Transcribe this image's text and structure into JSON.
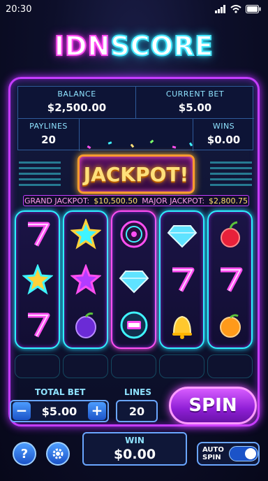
{
  "status_bar": {
    "time": "20:30",
    "icons": [
      "signal-icon",
      "wifi-icon",
      "battery-icon"
    ]
  },
  "logo": {
    "part1": "IDN",
    "part2": "SCORE"
  },
  "info": {
    "balance_label": "BALANCE",
    "balance_value": "$2,500.00",
    "bet_label": "CURRENT BET",
    "bet_value": "$5.00",
    "paylines_label": "PAYLINES",
    "paylines_value": "20",
    "wins_label": "WINS",
    "wins_value": "$0.00"
  },
  "jackpot": {
    "sign": "JACKPOT!",
    "grand_label": "GRAND JACKPOT:",
    "grand_value": "$10,500.50",
    "major_label": "MAJOR JACKPOT:",
    "major_value": "$2,800.75"
  },
  "reels": [
    [
      "seven-icon",
      "star-icon",
      "seven-icon"
    ],
    [
      "star-icon",
      "star-icon",
      "plum-icon"
    ],
    [
      "bonus-wheel-icon",
      "diamond-icon",
      "slot-machine-icon"
    ],
    [
      "diamond-icon",
      "seven-icon",
      "bell-icon"
    ],
    [
      "cherry-icon",
      "seven-icon",
      "orange-icon"
    ]
  ],
  "controls": {
    "total_bet_label": "TOTAL BET",
    "total_bet_value": "$5.00",
    "minus": "−",
    "plus": "+",
    "lines_label": "LINES",
    "lines_value": "20",
    "spin_label": "SPIN",
    "help": "?",
    "win_label": "WIN",
    "win_value": "$0.00",
    "auto_spin_label": "AUTO SPIN",
    "auto_spin_on": true
  },
  "colors": {
    "neon_pink": "#ff4ff2",
    "neon_cyan": "#2ef0ff",
    "gold": "#ffe07a",
    "purple": "#c53cff"
  }
}
